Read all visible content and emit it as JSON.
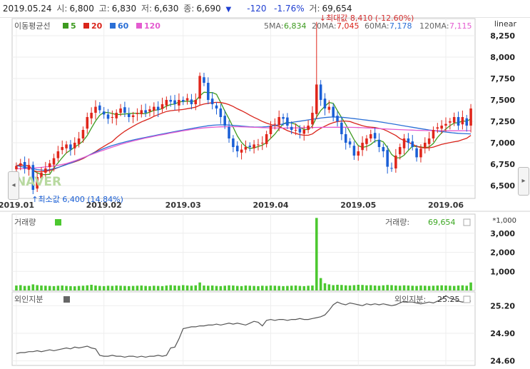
{
  "ohlc": {
    "date": "2019.05.24",
    "open_label": "시:",
    "open": "6,800",
    "high_label": "고:",
    "high": "6,830",
    "low_label": "저:",
    "low": "6,630",
    "close_label": "종:",
    "close": "6,690",
    "arrow": "▼",
    "change": "-120",
    "change_pct": "-1.76%",
    "volume_label": "거:",
    "volume": "69,654"
  },
  "scale_mode": "linear",
  "ma_legend": {
    "title": "이동평균선",
    "items": [
      {
        "label": "5",
        "color": "#3d9a1f"
      },
      {
        "label": "20",
        "color": "#d9241b"
      },
      {
        "label": "60",
        "color": "#2a6fd6"
      },
      {
        "label": "120",
        "color": "#e45bd0"
      }
    ]
  },
  "ma_values": [
    {
      "label": "5MA:",
      "value": "6,834",
      "color": "#3d9a1f"
    },
    {
      "label": "20MA:",
      "value": "7,045",
      "color": "#d9241b"
    },
    {
      "label": "60MA:",
      "value": "7,178",
      "color": "#2a6fd6"
    },
    {
      "label": "120MA:",
      "value": "7,115",
      "color": "#e45bd0"
    }
  ],
  "max_annotation": "최대값 8,410 (-12.60%)",
  "min_annotation": "최소값 6,400 (14.84%)",
  "watermark": "NAVER",
  "volume_panel": {
    "title": "거래량",
    "value_label": "거래량:",
    "value": "69,654",
    "multiplier": "*1,000",
    "color": "#4cc830"
  },
  "foreign_panel": {
    "title": "외인지분",
    "value_label": "외인지분:",
    "value": "25.25",
    "color": "#666666"
  },
  "chart_data": [
    {
      "type": "candlestick",
      "title": "",
      "x_labels": [
        "2019.01",
        "2019.02",
        "2019.03",
        "2019.04",
        "2019.05",
        "2019.06"
      ],
      "y_ticks": [
        6500,
        6750,
        7000,
        7250,
        7500,
        7750,
        8000,
        8250
      ],
      "ylim": [
        6350,
        8450
      ],
      "grid": true,
      "series": [
        {
          "name": "종가",
          "values": [
            6730,
            6760,
            6700,
            6740,
            6450,
            6600,
            6650,
            6700,
            6760,
            6820,
            6900,
            6950,
            6980,
            6920,
            7000,
            7050,
            7150,
            7300,
            7350,
            7420,
            7380,
            7330,
            7280,
            7300,
            7350,
            7400,
            7350,
            7300,
            7320,
            7350,
            7380,
            7350,
            7390,
            7420,
            7380,
            7450,
            7500,
            7480,
            7450,
            7500,
            7480,
            7520,
            7450,
            7500,
            7780,
            7700,
            7500,
            7450,
            7400,
            7300,
            7200,
            7050,
            6950,
            6900,
            6920,
            6950,
            6950,
            6980,
            6980,
            7000,
            7100,
            7200,
            7220,
            7300,
            7280,
            7200,
            7150,
            7150,
            7120,
            7150,
            7200,
            7350,
            7680,
            7500,
            7400,
            7420,
            7300,
            7250,
            7100,
            7000,
            6980,
            6850,
            6900,
            7000,
            7050,
            7100,
            7050,
            6950,
            6900,
            6720,
            6700,
            6850,
            6950,
            7050,
            7000,
            6950,
            6830,
            6930,
            7000,
            7050,
            7150,
            7180,
            7200,
            7220,
            7250,
            7300,
            7200,
            7300,
            7200,
            7400
          ]
        }
      ]
    },
    {
      "type": "bar",
      "title": "거래량",
      "unit": "*1,000",
      "y_ticks": [
        1000,
        2000,
        3000
      ],
      "series": [
        {
          "name": "거래량",
          "values": [
            260,
            280,
            240,
            250,
            320,
            280,
            260,
            250,
            240,
            230,
            250,
            260,
            240,
            230,
            220,
            240,
            250,
            270,
            300,
            260,
            240,
            230,
            250,
            240,
            260,
            250,
            240,
            230,
            240,
            250,
            260,
            240,
            230,
            250,
            240,
            230,
            260,
            280,
            260,
            250,
            280,
            260,
            250,
            270,
            420,
            260,
            250,
            260,
            240,
            230,
            250,
            270,
            260,
            240,
            230,
            260,
            250,
            240,
            230,
            250,
            240,
            260,
            250,
            240,
            230,
            240,
            250,
            260,
            240,
            230,
            250,
            260,
            3800,
            650,
            380,
            320,
            280,
            300,
            290,
            270,
            260,
            280,
            300,
            290,
            270,
            280,
            260,
            250,
            270,
            290,
            280,
            260,
            250,
            270,
            260,
            250,
            240,
            260,
            250,
            240,
            250,
            260,
            270,
            260,
            250,
            240,
            260,
            270,
            250,
            420
          ]
        }
      ]
    },
    {
      "type": "line",
      "title": "외인지분",
      "y_ticks": [
        24.6,
        24.9,
        25.2
      ],
      "ylim": [
        24.55,
        25.35
      ],
      "series": [
        {
          "name": "외인지분",
          "values": [
            24.68,
            24.69,
            24.69,
            24.7,
            24.7,
            24.71,
            24.7,
            24.71,
            24.72,
            24.71,
            24.72,
            24.73,
            24.74,
            24.73,
            24.75,
            24.74,
            24.75,
            24.76,
            24.74,
            24.73,
            24.66,
            24.65,
            24.65,
            24.66,
            24.65,
            24.65,
            24.64,
            24.65,
            24.65,
            24.64,
            24.65,
            24.64,
            24.65,
            24.65,
            24.66,
            24.65,
            24.66,
            24.74,
            24.75,
            24.84,
            24.95,
            24.96,
            24.97,
            24.97,
            24.98,
            24.98,
            24.99,
            24.99,
            25.0,
            24.99,
            25.0,
            25.01,
            25.0,
            25.01,
            25.0,
            24.99,
            25.01,
            25.03,
            25.02,
            24.98,
            25.04,
            25.05,
            25.04,
            25.05,
            25.05,
            25.04,
            25.05,
            25.05,
            25.06,
            25.05,
            25.05,
            25.06,
            25.07,
            25.08,
            25.1,
            25.15,
            25.21,
            25.24,
            25.22,
            25.21,
            25.23,
            25.22,
            25.21,
            25.2,
            25.22,
            25.21,
            25.22,
            25.21,
            25.22,
            25.21,
            25.2,
            25.21,
            25.23,
            25.25,
            25.24,
            25.24,
            25.23,
            25.22,
            25.23,
            25.24,
            25.23,
            25.25,
            25.27,
            25.31,
            25.28,
            25.27,
            25.25,
            25.24,
            25.25,
            25.25
          ]
        }
      ]
    }
  ]
}
